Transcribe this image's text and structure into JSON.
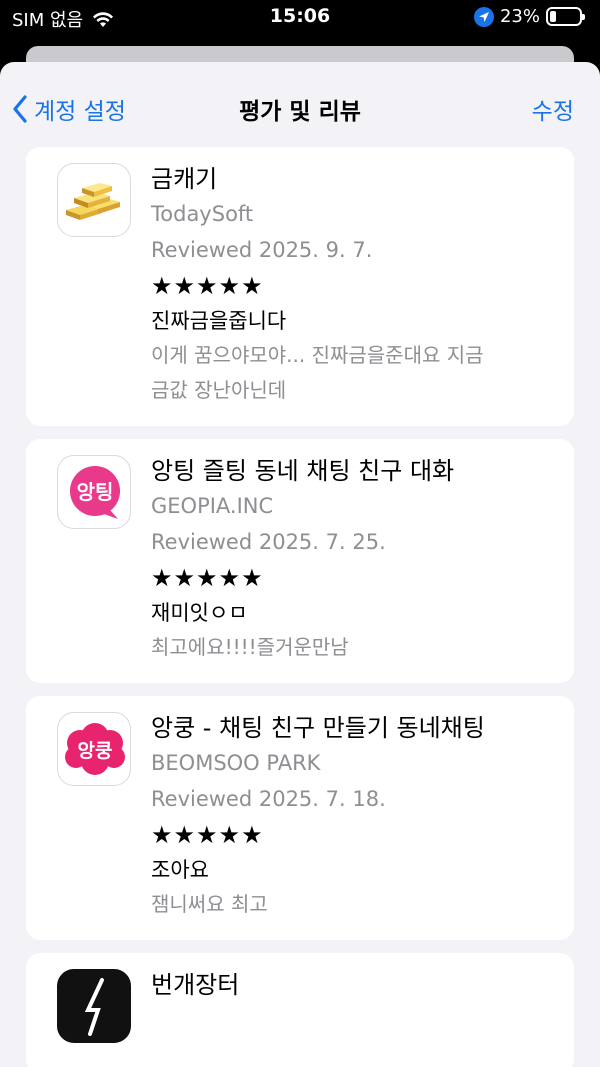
{
  "status_bar": {
    "carrier": "SIM 없음",
    "time": "15:06",
    "battery": "23%"
  },
  "nav": {
    "back_label": "계정 설정",
    "title": "평가 및 리뷰",
    "edit_label": "수정"
  },
  "reviews": [
    {
      "app_name": "금캐기",
      "developer": "TodaySoft",
      "reviewed": "Reviewed 2025. 9. 7.",
      "stars": "★★★★★",
      "title": "진짜금을줍니다",
      "body_lines": [
        "이게 꿈으야모야... 진짜금을준대요 지금",
        "금값 장난아닌데"
      ]
    },
    {
      "app_name": "앙팅 즐팅 동네 채팅 친구 대화",
      "developer": "GEOPIA.INC",
      "reviewed": "Reviewed 2025. 7. 25.",
      "stars": "★★★★★",
      "title": "재미잇ㅇㅁ",
      "body_lines": [
        "최고에요!!!!즐거운만남"
      ]
    },
    {
      "app_name": "앙쿵 - 채팅 친구 만들기 동네채팅",
      "developer": "BEOMSOO PARK",
      "reviewed": "Reviewed 2025. 7. 18.",
      "stars": "★★★★★",
      "title": "조아요",
      "body_lines": [
        "잼니써요 최고"
      ]
    },
    {
      "app_name": "번개장터"
    }
  ],
  "icons": {
    "app1": "gold-bars-icon",
    "app2": "pink-bubble-icon",
    "app3": "pink-cloud-icon",
    "app4": "dark-app-icon",
    "app2_text": "앙팅",
    "app3_text": "앙쿵"
  },
  "colors": {
    "accent": "#1a73e8",
    "background": "#f2f2f7",
    "card": "#ffffff",
    "secondary_text": "#8e8e93",
    "pink": "#e8398a"
  }
}
